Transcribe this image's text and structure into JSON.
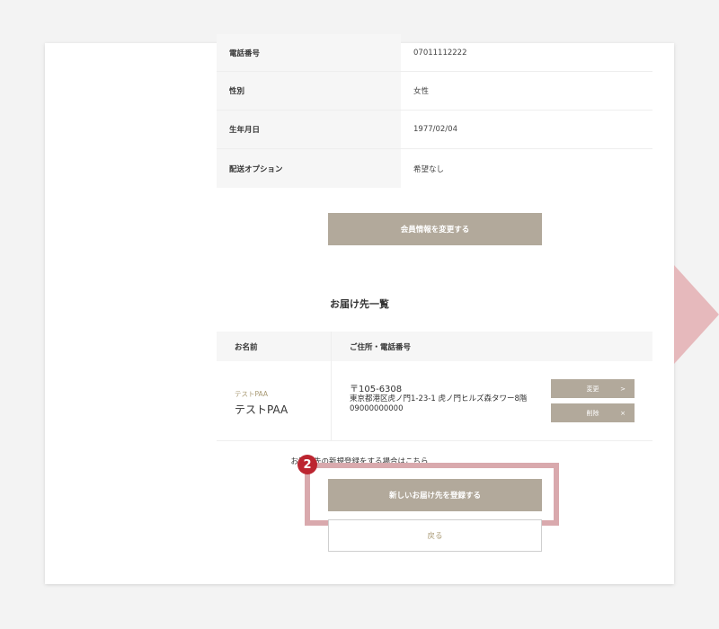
{
  "profile": {
    "rows": [
      {
        "label": "電話番号",
        "value": "07011112222"
      },
      {
        "label": "性別",
        "value": "女性"
      },
      {
        "label": "生年月日",
        "value": "1977/02/04"
      },
      {
        "label": "配送オプション",
        "value": "希望なし"
      }
    ],
    "edit_button": "会員情報を変更する"
  },
  "addresses": {
    "title": "お届け先一覧",
    "headers": {
      "name": "お名前",
      "address": "ご住所・電話番号"
    },
    "entry": {
      "kana": "テストPAA",
      "name": "テストPAA",
      "zip": "〒105-6308",
      "address": "東京都港区虎ノ門1-23-1 虎ノ門ヒルズ森タワー8階",
      "phone": "09000000000",
      "edit_label": "変更",
      "edit_icon": ">",
      "delete_label": "削除",
      "delete_icon": "×"
    }
  },
  "new_address": {
    "note": "お届け先の新規登録をする場合はこちら",
    "button": "新しいお届け先を登録する",
    "step_badge": "2"
  },
  "back_button": "戻る",
  "colors": {
    "accent_button": "#b2a99b",
    "highlight": "#d9a9ad",
    "badge": "#bc2530"
  }
}
